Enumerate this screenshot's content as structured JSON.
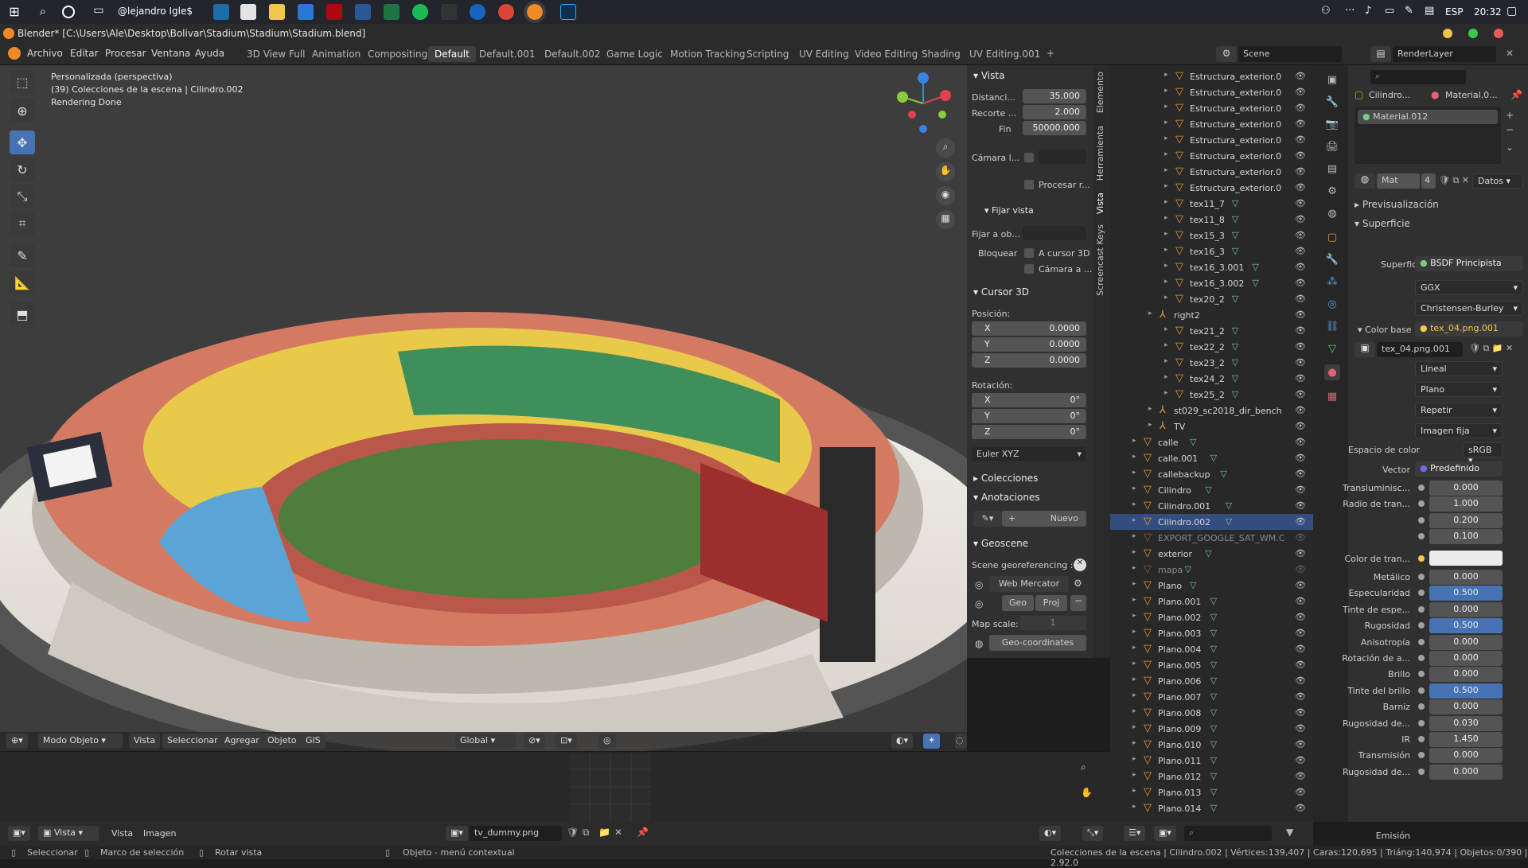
{
  "taskbar": {
    "user": "@lejandro Igle$",
    "lang": "ESP",
    "time": "20:32"
  },
  "window": {
    "title": "Blender* [C:\\Users\\Ale\\Desktop\\Bolivar\\Stadium\\Stadium\\Stadium.blend]"
  },
  "menu": {
    "items": [
      "Archivo",
      "Editar",
      "Procesar",
      "Ventana",
      "Ayuda"
    ]
  },
  "workspaces": [
    "3D View Full",
    "Animation",
    "Compositing",
    "Default",
    "Default.001",
    "Default.002",
    "Game Logic",
    "Motion Tracking",
    "Scripting",
    "UV Editing",
    "Video Editing",
    "Shading",
    "UV Editing.001"
  ],
  "active_workspace": "Default",
  "scene": {
    "name": "Scene",
    "render_layer": "RenderLayer"
  },
  "viewport": {
    "view_name": "Personalizada (perspectiva)",
    "collection_info": "(39) Colecciones de la escena | Cilindro.002",
    "render_status": "Rendering Done",
    "mode": "Modo Objeto",
    "header_menus": [
      "Vista",
      "Seleccionar",
      "Agregar",
      "Objeto",
      "GIS"
    ],
    "orientation": "Global"
  },
  "npanel": {
    "tabs": [
      "Elemento",
      "Herramienta",
      "Vista",
      "Screencast Keys"
    ],
    "vista_header": "Vista",
    "distancia_label": "Distanci...",
    "distancia": "35.000",
    "recorte_label": "Recorte ...",
    "recorte_inicio": "2.000",
    "fin_label": "Fin",
    "fin": "50000.000",
    "camara_label": "Cámara l...",
    "procesar_label": "Procesar r...",
    "fijar_vista": "Fijar vista",
    "fijar_a": "Fijar a ob...",
    "bloquear": "Bloquear",
    "a_cursor": "A cursor 3D",
    "camara_a": "Cámara a ...",
    "cursor_header": "Cursor 3D",
    "posicion": "Posición:",
    "pos": [
      {
        "axis": "X",
        "value": "0.0000"
      },
      {
        "axis": "Y",
        "value": "0.0000"
      },
      {
        "axis": "Z",
        "value": "0.0000"
      }
    ],
    "rotacion": "Rotación:",
    "rot": [
      {
        "axis": "X",
        "value": "0°"
      },
      {
        "axis": "Y",
        "value": "0°"
      },
      {
        "axis": "Z",
        "value": "0°"
      }
    ],
    "rot_mode": "Euler XYZ",
    "colecciones": "Colecciones",
    "anotaciones": "Anotaciones",
    "nuevo": "Nuevo",
    "geoscene": "Geoscene",
    "georef": "Scene georeferencing :",
    "web_mercator": "Web Mercator",
    "geo": "Geo",
    "proj": "Proj",
    "map_scale_label": "Map scale:",
    "map_scale": "1",
    "geo_coords": "Geo-coordinates"
  },
  "outliner": {
    "rows": [
      {
        "name": "Estructura_exterior.0",
        "indent": 3,
        "mesh": false
      },
      {
        "name": "Estructura_exterior.0",
        "indent": 3,
        "mesh": false
      },
      {
        "name": "Estructura_exterior.0",
        "indent": 3,
        "mesh": false
      },
      {
        "name": "Estructura_exterior.0",
        "indent": 3,
        "mesh": false
      },
      {
        "name": "Estructura_exterior.0",
        "indent": 3,
        "mesh": false
      },
      {
        "name": "Estructura_exterior.0",
        "indent": 3,
        "mesh": false
      },
      {
        "name": "Estructura_exterior.0",
        "indent": 3,
        "mesh": false
      },
      {
        "name": "Estructura_exterior.0",
        "indent": 3,
        "mesh": false
      },
      {
        "name": "tex11_7",
        "indent": 3,
        "mesh": true
      },
      {
        "name": "tex11_8",
        "indent": 3,
        "mesh": true
      },
      {
        "name": "tex15_3",
        "indent": 3,
        "mesh": true
      },
      {
        "name": "tex16_3",
        "indent": 3,
        "mesh": true
      },
      {
        "name": "tex16_3.001",
        "indent": 3,
        "mesh": true
      },
      {
        "name": "tex16_3.002",
        "indent": 3,
        "mesh": true
      },
      {
        "name": "tex20_2",
        "indent": 3,
        "mesh": true
      },
      {
        "name": "right2",
        "indent": 2,
        "mesh": false,
        "empty": true
      },
      {
        "name": "tex21_2",
        "indent": 3,
        "mesh": true
      },
      {
        "name": "tex22_2",
        "indent": 3,
        "mesh": true
      },
      {
        "name": "tex23_2",
        "indent": 3,
        "mesh": true
      },
      {
        "name": "tex24_2",
        "indent": 3,
        "mesh": true
      },
      {
        "name": "tex25_2",
        "indent": 3,
        "mesh": true
      },
      {
        "name": "st029_sc2018_dir_bench",
        "indent": 2,
        "mesh": false,
        "empty": true
      },
      {
        "name": "TV",
        "indent": 2,
        "mesh": false,
        "empty": true
      },
      {
        "name": "calle",
        "indent": 1,
        "mesh": true
      },
      {
        "name": "calle.001",
        "indent": 1,
        "mesh": true
      },
      {
        "name": "callebackup",
        "indent": 1,
        "mesh": true
      },
      {
        "name": "Cilindro",
        "indent": 1,
        "mesh": true
      },
      {
        "name": "Cilindro.001",
        "indent": 1,
        "mesh": true
      },
      {
        "name": "Cilindro.002",
        "indent": 1,
        "mesh": true,
        "selected": true
      },
      {
        "name": "EXPORT_GOOGLE_SAT_WM.C",
        "indent": 1,
        "mesh": false,
        "dim": true
      },
      {
        "name": "exterior",
        "indent": 1,
        "mesh": true
      },
      {
        "name": "mapa",
        "indent": 1,
        "mesh": true,
        "dim": true
      },
      {
        "name": "Plano",
        "indent": 1,
        "mesh": true
      },
      {
        "name": "Plano.001",
        "indent": 1,
        "mesh": true
      },
      {
        "name": "Plano.002",
        "indent": 1,
        "mesh": true
      },
      {
        "name": "Plano.003",
        "indent": 1,
        "mesh": true
      },
      {
        "name": "Plano.004",
        "indent": 1,
        "mesh": true
      },
      {
        "name": "Plano.005",
        "indent": 1,
        "mesh": true
      },
      {
        "name": "Plano.006",
        "indent": 1,
        "mesh": true
      },
      {
        "name": "Plano.007",
        "indent": 1,
        "mesh": true
      },
      {
        "name": "Plano.008",
        "indent": 1,
        "mesh": true
      },
      {
        "name": "Plano.009",
        "indent": 1,
        "mesh": true
      },
      {
        "name": "Plano.010",
        "indent": 1,
        "mesh": true
      },
      {
        "name": "Plano.011",
        "indent": 1,
        "mesh": true
      },
      {
        "name": "Plano.012",
        "indent": 1,
        "mesh": true
      },
      {
        "name": "Plano.013",
        "indent": 1,
        "mesh": true
      },
      {
        "name": "Plano.014",
        "indent": 1,
        "mesh": true
      }
    ]
  },
  "properties": {
    "object": "Cilindro...",
    "material_name_short": "Material.0...",
    "slot": "Material.012",
    "mat_tab": "Mat",
    "mat_users": "4",
    "datos": "Datos",
    "preview": "Previsualización",
    "surface_header": "Superficie",
    "surface_label": "Superficie",
    "shader": "BSDF Principista",
    "distribution": "GGX",
    "subsurface_method": "Christensen-Burley",
    "color_base": "Color base",
    "texture": "tex_04.png.001",
    "image": "tex_04.png.001",
    "interp": "Lineal",
    "proj": "Plano",
    "ext": "Repetir",
    "source": "Imagen fija",
    "color_space_label": "Espacio de color",
    "color_space": "sRGB",
    "vector_label": "Vector",
    "vector": "Predefinido",
    "fields": [
      {
        "label": "Transluminisc...",
        "value": "0.000",
        "blue": false
      },
      {
        "label": "Radio de tran...",
        "value": "1.000",
        "blue": false
      },
      {
        "label": "",
        "value": "0.200",
        "blue": false
      },
      {
        "label": "",
        "value": "0.100",
        "blue": false
      }
    ],
    "color_tran_label": "Color de tran...",
    "fields2": [
      {
        "label": "Metálico",
        "value": "0.000",
        "blue": false
      },
      {
        "label": "Especularidad",
        "value": "0.500",
        "blue": true
      },
      {
        "label": "Tinte de espe...",
        "value": "0.000",
        "blue": false
      },
      {
        "label": "Rugosidad",
        "value": "0.500",
        "blue": true
      },
      {
        "label": "Anisotropía",
        "value": "0.000",
        "blue": false
      },
      {
        "label": "Rotación de a...",
        "value": "0.000",
        "blue": false
      },
      {
        "label": "Brillo",
        "value": "0.000",
        "blue": false
      },
      {
        "label": "Tinte del brillo",
        "value": "0.500",
        "blue": true
      },
      {
        "label": "Barniz",
        "value": "0.000",
        "blue": false
      },
      {
        "label": "Rugosidad de...",
        "value": "0.030",
        "blue": false
      },
      {
        "label": "IR",
        "value": "1.450",
        "blue": false
      },
      {
        "label": "Transmisión",
        "value": "0.000",
        "blue": false
      },
      {
        "label": "Rugosidad de...",
        "value": "0.000",
        "blue": false
      }
    ],
    "emision_label": "Emisión"
  },
  "image_editor": {
    "view_menu": "Vista",
    "menus": [
      "Vista",
      "Imagen"
    ],
    "image": "tv_dummy.png"
  },
  "status": {
    "select": "Seleccionar",
    "box": "Marco de selección",
    "rotate": "Rotar vista",
    "context": "Objeto - menú contextual",
    "stats": "Colecciones de la escena | Cilindro.002 | Vértices:139,407 | Caras:120,695 | Triáng:140,974 | Objetos:0/390 | 2.92.0"
  },
  "colors": {
    "accent": "#4772b3",
    "object_orange": "#e59a3c",
    "mesh_green": "#7acb8a"
  }
}
